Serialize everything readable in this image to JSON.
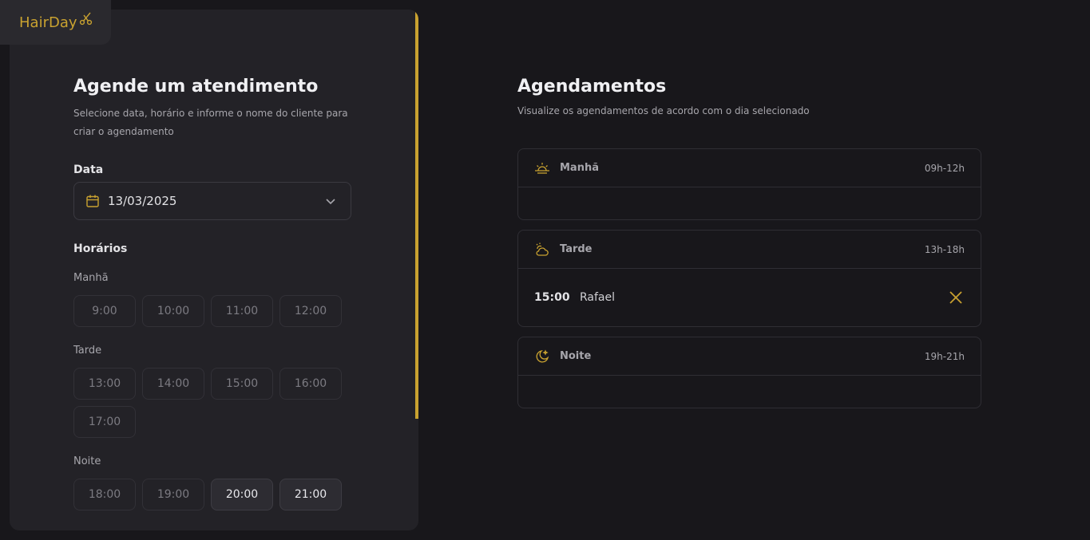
{
  "app": {
    "logo_text": "HairDay"
  },
  "form": {
    "title": "Agende um atendimento",
    "subtitle": "Selecione data, horário e informe o nome do cliente para criar o agendamento",
    "date_label": "Data",
    "date_value": "13/03/2025",
    "hours_label": "Horários",
    "periods": {
      "morning": {
        "label": "Manhã",
        "slots": [
          "9:00",
          "10:00",
          "11:00",
          "12:00"
        ]
      },
      "afternoon": {
        "label": "Tarde",
        "slots": [
          "13:00",
          "14:00",
          "15:00",
          "16:00",
          "17:00"
        ]
      },
      "night": {
        "label": "Noite",
        "slots": [
          "18:00",
          "19:00",
          "20:00",
          "21:00"
        ]
      }
    }
  },
  "schedule": {
    "title": "Agendamentos",
    "subtitle": "Visualize os agendamentos de acordo com o dia selecionado",
    "periods": {
      "morning": {
        "name": "Manhã",
        "range": "09h-12h"
      },
      "afternoon": {
        "name": "Tarde",
        "range": "13h-18h",
        "appointments": [
          {
            "time": "15:00",
            "client": "Rafael"
          }
        ]
      },
      "night": {
        "name": "Noite",
        "range": "19h-21h"
      }
    }
  },
  "colors": {
    "accent": "#c9a230",
    "background": "#18171b",
    "panel": "#232227"
  },
  "icons": [
    "scissors-icon",
    "calendar-icon",
    "chevron-down-icon",
    "sunrise-icon",
    "cloud-sun-icon",
    "moon-stars-icon",
    "close-icon"
  ]
}
